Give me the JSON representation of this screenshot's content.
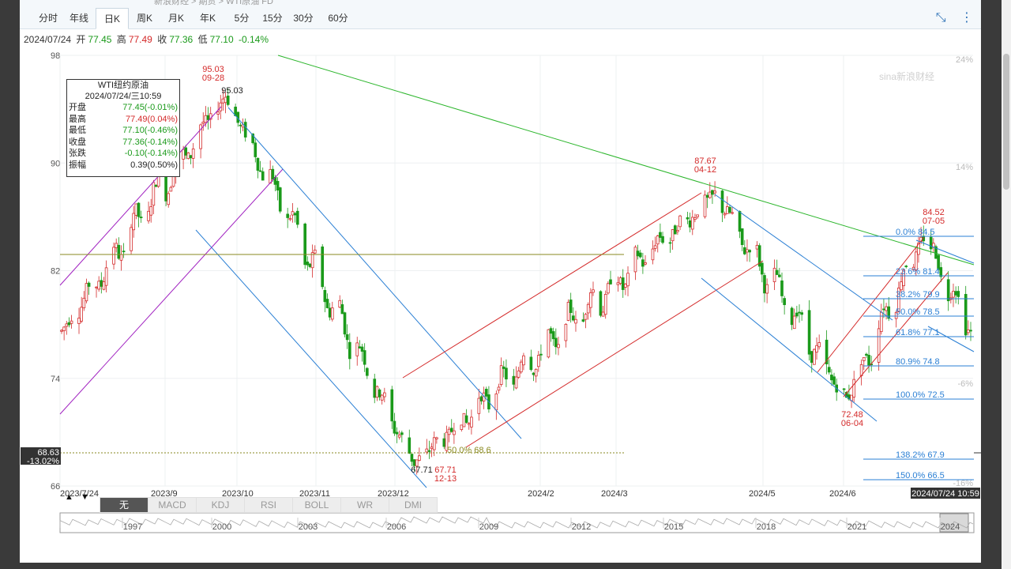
{
  "breadcrumb": "新浪财经 > 期货 > WTI原油 FD",
  "tabs": [
    {
      "label": "分时",
      "active": false
    },
    {
      "label": "年线",
      "active": false
    },
    {
      "label": "日K",
      "active": true
    },
    {
      "label": "周K",
      "active": false
    },
    {
      "label": "月K",
      "active": false
    },
    {
      "label": "年K",
      "active": false
    },
    {
      "label": "5分",
      "active": false
    },
    {
      "label": "15分",
      "active": false
    },
    {
      "label": "30分",
      "active": false
    },
    {
      "label": "60分",
      "active": false
    }
  ],
  "top_icons": [
    "shrink-icon",
    "more-vertical-icon"
  ],
  "info": {
    "date": "2024/07/24",
    "open_label": "开",
    "open": "77.45",
    "high_label": "高",
    "high": "77.49",
    "close_label": "收",
    "close": "77.36",
    "low_label": "低",
    "low": "77.10",
    "change_pct": "-0.14%"
  },
  "legend": {
    "title": "WTI纽约原油",
    "datetime": "2024/07/24/三10:59",
    "rows": [
      {
        "k": "开盘",
        "v": "77.45(-0.01%)",
        "c": "#1a9a1a"
      },
      {
        "k": "最高",
        "v": "77.49(0.04%)",
        "c": "#d42a2a"
      },
      {
        "k": "最低",
        "v": "77.10(-0.46%)",
        "c": "#1a9a1a"
      },
      {
        "k": "收盘",
        "v": "77.36(-0.14%)",
        "c": "#1a9a1a"
      },
      {
        "k": "张跌",
        "v": "-0.10(-0.14%)",
        "c": "#1a9a1a"
      },
      {
        "k": "振幅",
        "v": "0.39(0.50%)",
        "c": "#222"
      }
    ]
  },
  "indicators": {
    "items": [
      "无",
      "MACD",
      "KDJ",
      "RSI",
      "BOLL",
      "WR",
      "DMI"
    ],
    "active": "无"
  },
  "nav_arrows": [
    "▲",
    "▼"
  ],
  "colors": {
    "up": "#d42a2a",
    "down": "#1a9a1a",
    "trend": "#2a7fd4",
    "channel_red": "#d42a2a",
    "channel_purple": "#a020c0",
    "trend_green": "#2ab52a",
    "fib": "#2a7fd4",
    "support": "#8a8a20"
  },
  "chart_data": {
    "type": "candlestick",
    "title": "WTI纽约原油",
    "period": "日K",
    "ylim": [
      66,
      98
    ],
    "y_ticks": [
      "98",
      "90",
      "82",
      "74",
      "66"
    ],
    "right_pct_ticks": [
      "24%",
      "14%",
      "-6%",
      "-16%"
    ],
    "x_ticks": [
      "2023/7/24",
      "2023/9",
      "2023/10",
      "2023/11",
      "2023/12",
      "2024/2",
      "2024/3",
      "2024/5",
      "2024/6"
    ],
    "current_label": "2024/07/24 10:59",
    "price_marker": {
      "value": "68.63",
      "pct": "-13.02%"
    },
    "watermark": "sina新浪财经",
    "annotations": [
      {
        "price": "95.03",
        "date": "09-28",
        "kind": "high"
      },
      {
        "price": "95.03",
        "kind": "high_plain"
      },
      {
        "price": "87.67",
        "date": "04-12",
        "kind": "high"
      },
      {
        "price": "84.52",
        "date": "07-05",
        "kind": "high"
      },
      {
        "price": "67.71",
        "date": "12-13",
        "kind": "low"
      },
      {
        "price": "67.71",
        "kind": "low_plain"
      },
      {
        "price": "72.48",
        "date": "06-04",
        "kind": "low"
      },
      {
        "text": "50.0% 68.6",
        "kind": "fib_old"
      }
    ],
    "fib_levels": [
      {
        "label": "0.0% 84.5"
      },
      {
        "label": "23.6% 81.4"
      },
      {
        "label": "38.2% 79.9"
      },
      {
        "label": "50.0% 78.5"
      },
      {
        "label": "61.8% 77.1"
      },
      {
        "label": "80.9% 74.8"
      },
      {
        "label": "100.0% 72.5"
      },
      {
        "label": "138.2% 67.9"
      },
      {
        "label": "150.0% 66.5"
      }
    ],
    "key_points": [
      {
        "date": "2023-07-24",
        "close": 77.5
      },
      {
        "date": "2023-09-28",
        "close": 95.03
      },
      {
        "date": "2023-12-13",
        "close": 67.71
      },
      {
        "date": "2024-04-12",
        "close": 87.67
      },
      {
        "date": "2024-06-04",
        "close": 72.48
      },
      {
        "date": "2024-07-05",
        "close": 84.52
      },
      {
        "date": "2024-07-24",
        "close": 77.36
      }
    ],
    "navigator_years": [
      "1997",
      "2000",
      "2003",
      "2006",
      "2009",
      "2012",
      "2015",
      "2018",
      "2021",
      "2024"
    ]
  }
}
